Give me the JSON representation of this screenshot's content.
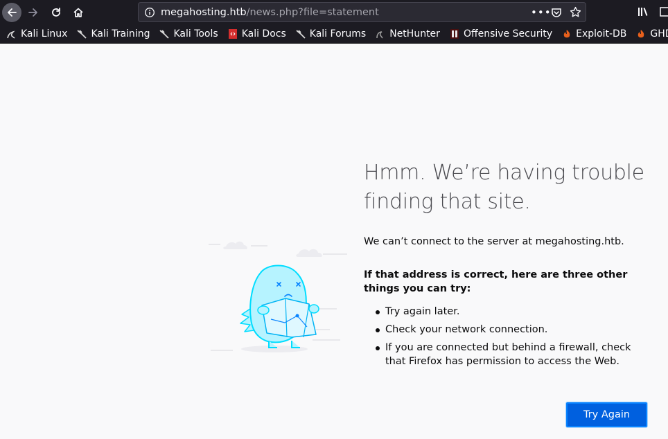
{
  "browser": {
    "url_host": "megahosting.htb",
    "url_path": "/news.php?file=statement",
    "url_more": "•••",
    "bookmarks": [
      {
        "label": "Kali Linux",
        "icon": "kali-dragon-icon"
      },
      {
        "label": "Kali Training",
        "icon": "kali-dragon-icon"
      },
      {
        "label": "Kali Tools",
        "icon": "kali-dragon-icon"
      },
      {
        "label": "Kali Docs",
        "icon": "kali-docs-icon"
      },
      {
        "label": "Kali Forums",
        "icon": "kali-dragon-icon"
      },
      {
        "label": "NetHunter",
        "icon": "nethunter-icon"
      },
      {
        "label": "Offensive Security",
        "icon": "offsec-icon"
      },
      {
        "label": "Exploit-DB",
        "icon": "exploitdb-icon"
      },
      {
        "label": "GHDB",
        "icon": "ghdb-icon"
      }
    ]
  },
  "error_page": {
    "title": "Hmm. We’re having trouble finding that site.",
    "description": "We can’t connect to the server at megahosting.htb.",
    "tips_heading": "If that address is correct, here are three other things you can try:",
    "tips": [
      "Try again later.",
      "Check your network connection.",
      "If you are connected but behind a firewall, check that Firefox has permission to access the Web."
    ],
    "try_again_label": "Try Again"
  },
  "colors": {
    "toolbar_bg": "#1c1b22",
    "page_bg": "#f9f9fa",
    "button_blue": "#0060df",
    "illustration_blue": "#00ddff"
  }
}
